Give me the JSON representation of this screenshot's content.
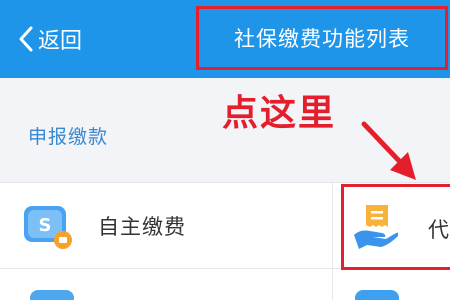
{
  "header": {
    "back_label": "返回",
    "title": "社保缴费功能列表"
  },
  "annotation": {
    "text": "点这里"
  },
  "section": {
    "title": "申报缴款"
  },
  "items": [
    {
      "label": "自主缴费",
      "icon": "social-security-card-icon"
    },
    {
      "label": "代",
      "icon": "payment-hand-icon"
    }
  ],
  "colors": {
    "header_blue": "#1f95ea",
    "highlight_red": "#e5202e",
    "section_title_blue": "#3a88cf"
  }
}
